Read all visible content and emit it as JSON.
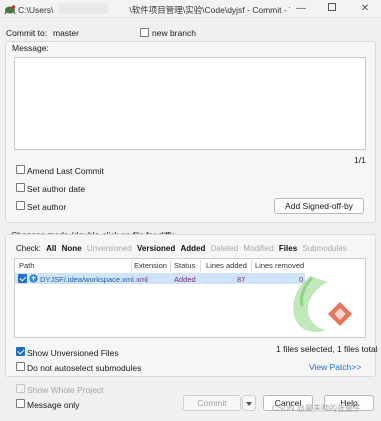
{
  "window": {
    "title_prefix": "C:\\Users\\",
    "title_suffix": "\\软件项目管理\\实验\\Code\\dyjsf - Commit - Tortois...",
    "minimize_glyph": "—",
    "close_glyph": "✕"
  },
  "commit_to": {
    "label": "Commit to:",
    "branch": "master",
    "new_branch_label": "new branch",
    "new_branch_checked": false
  },
  "message": {
    "label": "Message:",
    "text": "",
    "position": "1/1"
  },
  "options": {
    "amend": {
      "label": "Amend Last Commit",
      "checked": false
    },
    "author_date": {
      "label": "Set author date",
      "checked": false
    },
    "author": {
      "label": "Set author",
      "checked": false
    },
    "signed_off_label": "Add Signed-off-by"
  },
  "changes": {
    "label": "Changes made (double-click on file for diff):",
    "check_label": "Check:",
    "filters": [
      {
        "label": "All",
        "style": "bold"
      },
      {
        "label": "None",
        "style": "bold"
      },
      {
        "label": "Unversioned",
        "style": "gray"
      },
      {
        "label": "Versioned",
        "style": "bold"
      },
      {
        "label": "Added",
        "style": "bold"
      },
      {
        "label": "Deleted",
        "style": "gray"
      },
      {
        "label": "Modified",
        "style": "gray"
      },
      {
        "label": "Files",
        "style": "bold"
      },
      {
        "label": "Submodules",
        "style": "gray"
      }
    ],
    "columns": [
      "Path",
      "Extension",
      "Status",
      "Lines added",
      "Lines removed"
    ],
    "rows": [
      {
        "path": "DYJSF/.idea/workspace.xml",
        "extension": ".xml",
        "status": "Added",
        "lines_added": "87",
        "lines_removed": "0",
        "checked": true
      }
    ],
    "show_unversioned": {
      "label": "Show Unversioned Files",
      "checked": true
    },
    "no_autoselect": {
      "label": "Do not autoselect submodules",
      "checked": false
    },
    "summary": "1 files selected, 1 files total",
    "view_patch": "View Patch>>"
  },
  "footer": {
    "show_whole_project": {
      "label": "Show Whole Project",
      "checked": false,
      "enabled": false
    },
    "message_only": {
      "label": "Message only",
      "checked": false
    },
    "commit_label": "Commit",
    "cancel_label": "Cancel",
    "help_label": "Help"
  },
  "watermark": "CSDN @黑夫帅的张龍子",
  "colors": {
    "accent": "#1f6fc6",
    "added_text": "#7b2f86",
    "link": "#1c6fd1",
    "selection": "#cfe3f7"
  }
}
